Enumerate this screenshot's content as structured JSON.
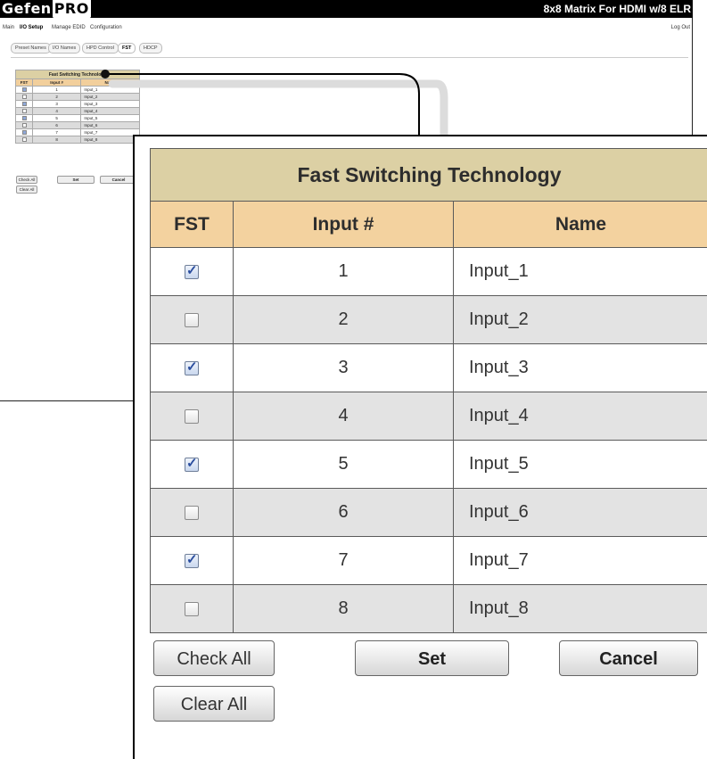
{
  "header": {
    "logo_part1": "Gefen",
    "logo_part2": "PRO",
    "product_title": "8x8 Matrix For HDMI w/8 ELR",
    "logout_label": "Log Out"
  },
  "main_menu": [
    "Main",
    "I/O Setup",
    "Manage EDID",
    "Configuration"
  ],
  "sub_tabs": [
    "Preset Names",
    "I/O Names",
    "HPD Control",
    "FST",
    "HDCP"
  ],
  "fst_panel": {
    "title": "Fast Switching Technology",
    "col_fst": "FST",
    "col_input": "Input #",
    "col_name": "Name",
    "rows": [
      {
        "num": "1",
        "name": "Input_1",
        "checked": true
      },
      {
        "num": "2",
        "name": "Input_2",
        "checked": false
      },
      {
        "num": "3",
        "name": "Input_3",
        "checked": true
      },
      {
        "num": "4",
        "name": "Input_4",
        "checked": false
      },
      {
        "num": "5",
        "name": "Input_5",
        "checked": true
      },
      {
        "num": "6",
        "name": "Input_6",
        "checked": false
      },
      {
        "num": "7",
        "name": "Input_7",
        "checked": true
      },
      {
        "num": "8",
        "name": "Input_8",
        "checked": false
      }
    ]
  },
  "buttons": {
    "check_all": "Check All",
    "set": "Set",
    "cancel": "Cancel",
    "clear_all": "Clear All"
  },
  "colors": {
    "title_bg": "#dcd0a4",
    "header_bg": "#f3d29f",
    "alt_row_bg": "#e3e3e3",
    "checkbox_check": "#2a4d9e"
  }
}
